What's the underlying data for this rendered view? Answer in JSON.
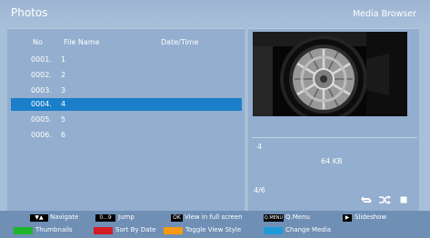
{
  "header": {
    "title": "Photos",
    "app_name": "Media Browser"
  },
  "table": {
    "columns": {
      "no": "No",
      "file_name": "File Name",
      "date_time": "Date/Time"
    },
    "rows": [
      {
        "no": "0001.",
        "name": "1"
      },
      {
        "no": "0002.",
        "name": "2"
      },
      {
        "no": "0003.",
        "name": "3"
      },
      {
        "no": "0004.",
        "name": "4",
        "selected": true
      },
      {
        "no": "0005.",
        "name": "5"
      },
      {
        "no": "0006.",
        "name": "6"
      }
    ]
  },
  "info": {
    "file_name": "4",
    "file_size": "64 KB",
    "position": "4/6"
  },
  "controls": [
    "repeat-icon",
    "shuffle-icon",
    "stop-icon"
  ],
  "footer": {
    "row1": [
      {
        "key": "▼▲",
        "label": "Navigate"
      },
      {
        "key": "0...9",
        "label": "Jump"
      },
      {
        "key": "OK",
        "label": "View in full screen"
      },
      {
        "key": "Q.MENU",
        "label": "Q.Menu"
      },
      {
        "key": "▶",
        "label": "Slideshow"
      }
    ],
    "row2": [
      {
        "color": "#1fb52b",
        "label": "Thumbnails"
      },
      {
        "color": "#d31c24",
        "label": "Sort By Date"
      },
      {
        "color": "#f59a12",
        "label": "Toggle View Style"
      },
      {
        "color": "#1e9bd7",
        "label": "Change Media"
      }
    ]
  },
  "colors": {
    "background": "#a8bfd8",
    "panel": "#93aece",
    "selection": "#1a7fc8",
    "footer": "#6f8fb5"
  }
}
